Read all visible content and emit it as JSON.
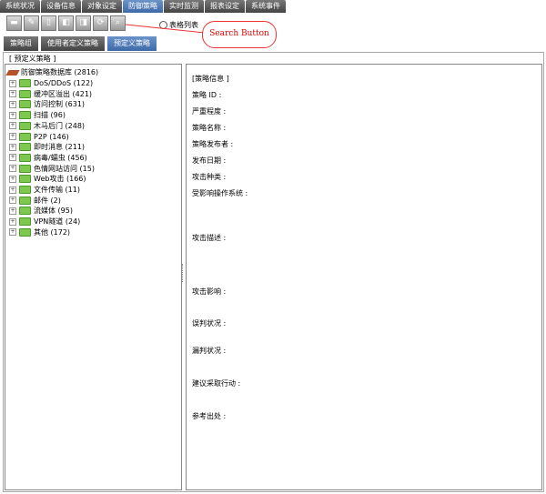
{
  "tabs": [
    "系统状况",
    "设备信息",
    "对象设定",
    "防御策略",
    "实时监测",
    "报表设定",
    "系统事件"
  ],
  "active_tab": 3,
  "toolbar": [
    "add",
    "edit",
    "delete",
    "import",
    "export",
    "refresh",
    "search"
  ],
  "radio_label": "表格列表",
  "callout": "Search Button",
  "subtabs": [
    "策略组",
    "使用者定义策略",
    "预定义策略"
  ],
  "active_subtab": 2,
  "fieldset_legend": "[ 预定义策略 ]",
  "tree": {
    "root": "防御策略数据库 (2816)",
    "items": [
      "DoS/DDoS (122)",
      "缓冲区溢出 (421)",
      "访问控制 (631)",
      "扫描 (96)",
      "木马后门 (248)",
      "P2P (146)",
      "即时消息 (211)",
      "病毒/蠕虫 (456)",
      "色情网站访问 (15)",
      "Web攻击 (166)",
      "文件传输 (11)",
      "邮件 (2)",
      "流媒体 (95)",
      "VPN隧道 (24)",
      "其他 (172)"
    ]
  },
  "details": [
    "[策略信息 ]",
    "策略 ID :",
    "严重程度 :",
    "策略名称 :",
    "策略发布者 :",
    "发布日期 :",
    "攻击种类 :",
    "受影响操作系统 :",
    "攻击描述 :",
    "攻击影响 :",
    "误判状况 :",
    "漏判状况 :",
    "建议采取行动 :",
    "参考出处 :"
  ]
}
